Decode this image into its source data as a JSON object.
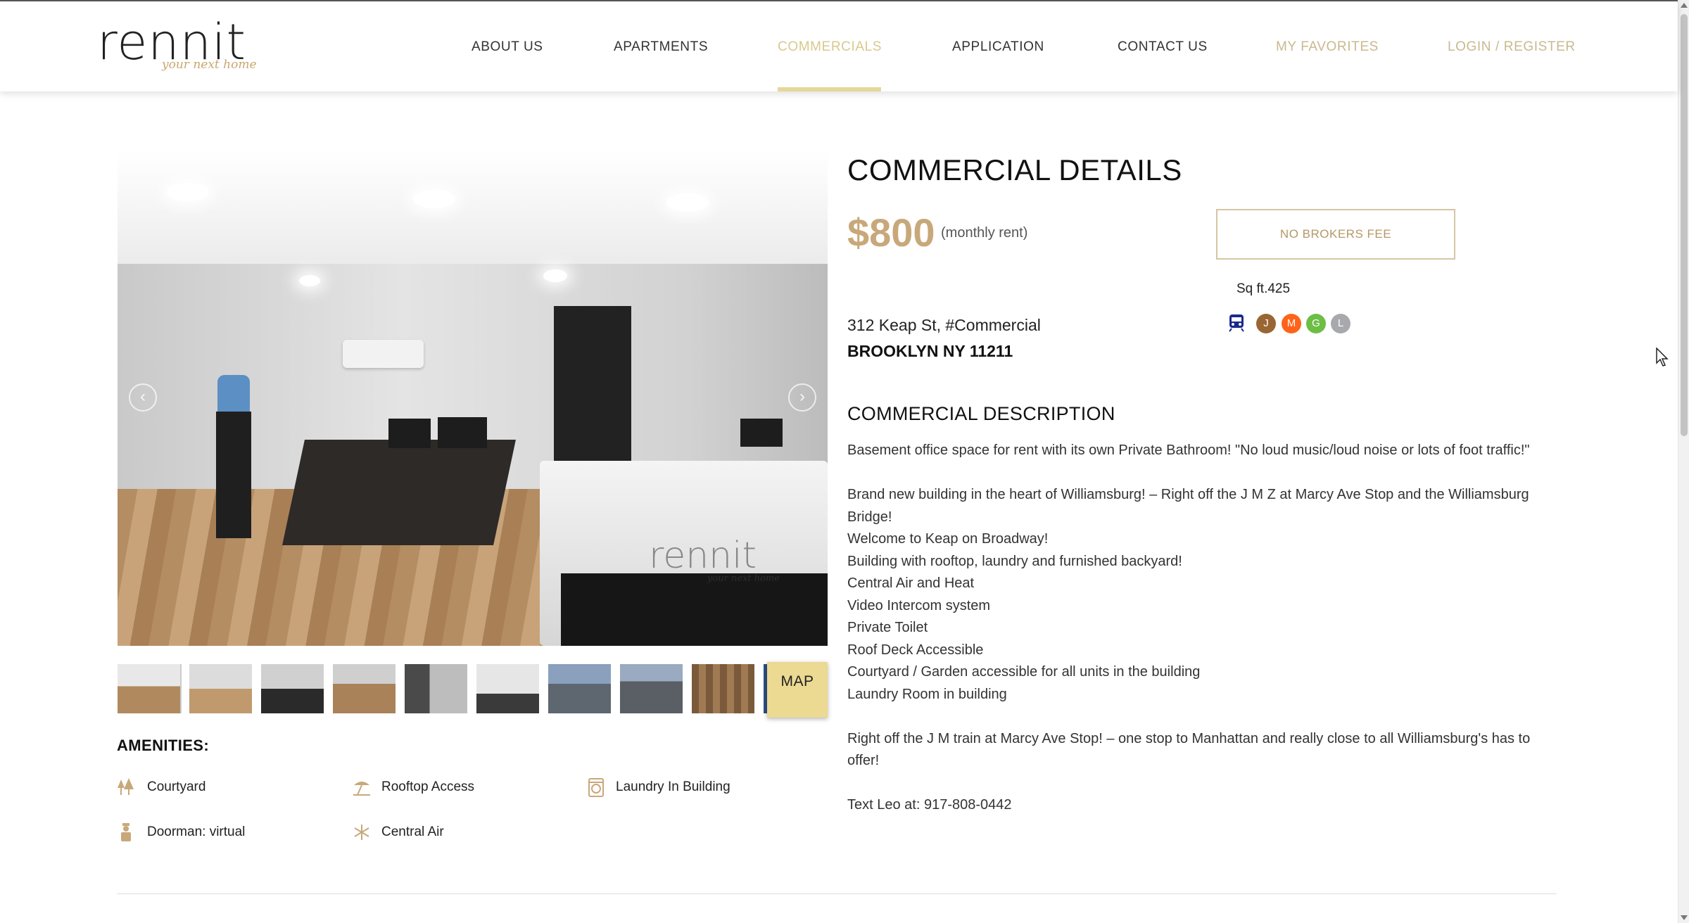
{
  "brand": {
    "name": "rennit",
    "tagline": "your next home"
  },
  "nav": {
    "items": [
      {
        "label": "ABOUT US"
      },
      {
        "label": "APARTMENTS"
      },
      {
        "label": "COMMERCIALS"
      },
      {
        "label": "APPLICATION"
      },
      {
        "label": "CONTACT US"
      },
      {
        "label": "MY FAVORITES"
      },
      {
        "label": "LOGIN / REGISTER"
      }
    ],
    "active": "COMMERCIALS"
  },
  "gallery": {
    "watermark": "rennit",
    "watermark_tag": "your next home",
    "prev_icon": "chevron-left-icon",
    "next_icon": "chevron-right-icon",
    "thumbnail_count": 10,
    "map_label": "MAP"
  },
  "amenities": {
    "title": "AMENITIES:",
    "items": [
      {
        "label": "Courtyard",
        "icon": "trees-icon"
      },
      {
        "label": "Rooftop Access",
        "icon": "sun-umbrella-icon"
      },
      {
        "label": "Laundry In Building",
        "icon": "washing-machine-icon"
      },
      {
        "label": "Doorman: virtual",
        "icon": "doorman-icon"
      },
      {
        "label": "Central Air",
        "icon": "snowflake-icon"
      }
    ]
  },
  "details": {
    "title": "COMMERCIAL DETAILS",
    "price": "$800",
    "price_note": "(monthly rent)",
    "fee_badge": "NO BROKERS FEE",
    "sqft": "Sq ft.425",
    "address_line1": "312 Keap St, #Commercial",
    "address_line2": "BROOKLYN NY 11211",
    "subway_lines": [
      {
        "label": "J",
        "color": "#996633"
      },
      {
        "label": "M",
        "color": "#ff6319"
      },
      {
        "label": "G",
        "color": "#6cbe45"
      },
      {
        "label": "L",
        "color": "#a7a9ac"
      }
    ]
  },
  "description": {
    "title": "COMMERCIAL DESCRIPTION",
    "paragraphs": [
      "Basement office space for rent with its own Private Bathroom! \"No loud music/loud noise or lots of foot traffic!\"",
      "",
      "Brand new building in the heart of Williamsburg! – Right off the J M Z at Marcy Ave Stop and the Williamsburg Bridge!",
      "Welcome to Keap on Broadway!",
      "Building with rooftop, laundry and furnished backyard!",
      "Central Air and Heat",
      "Video Intercom system",
      "Private Toilet",
      "Roof Deck Accessible",
      "Courtyard / Garden accessible for all units in the building",
      "Laundry Room in building",
      "",
      "Right off the J M train at Marcy Ave Stop! – one stop to Manhattan and really close to all Williamsburg's has to offer!",
      "",
      "Text Leo at: 917-808-0442"
    ]
  },
  "colors": {
    "accent": "#c8a87a",
    "nav_active": "#d8c98f",
    "map_button": "#ecd992"
  }
}
